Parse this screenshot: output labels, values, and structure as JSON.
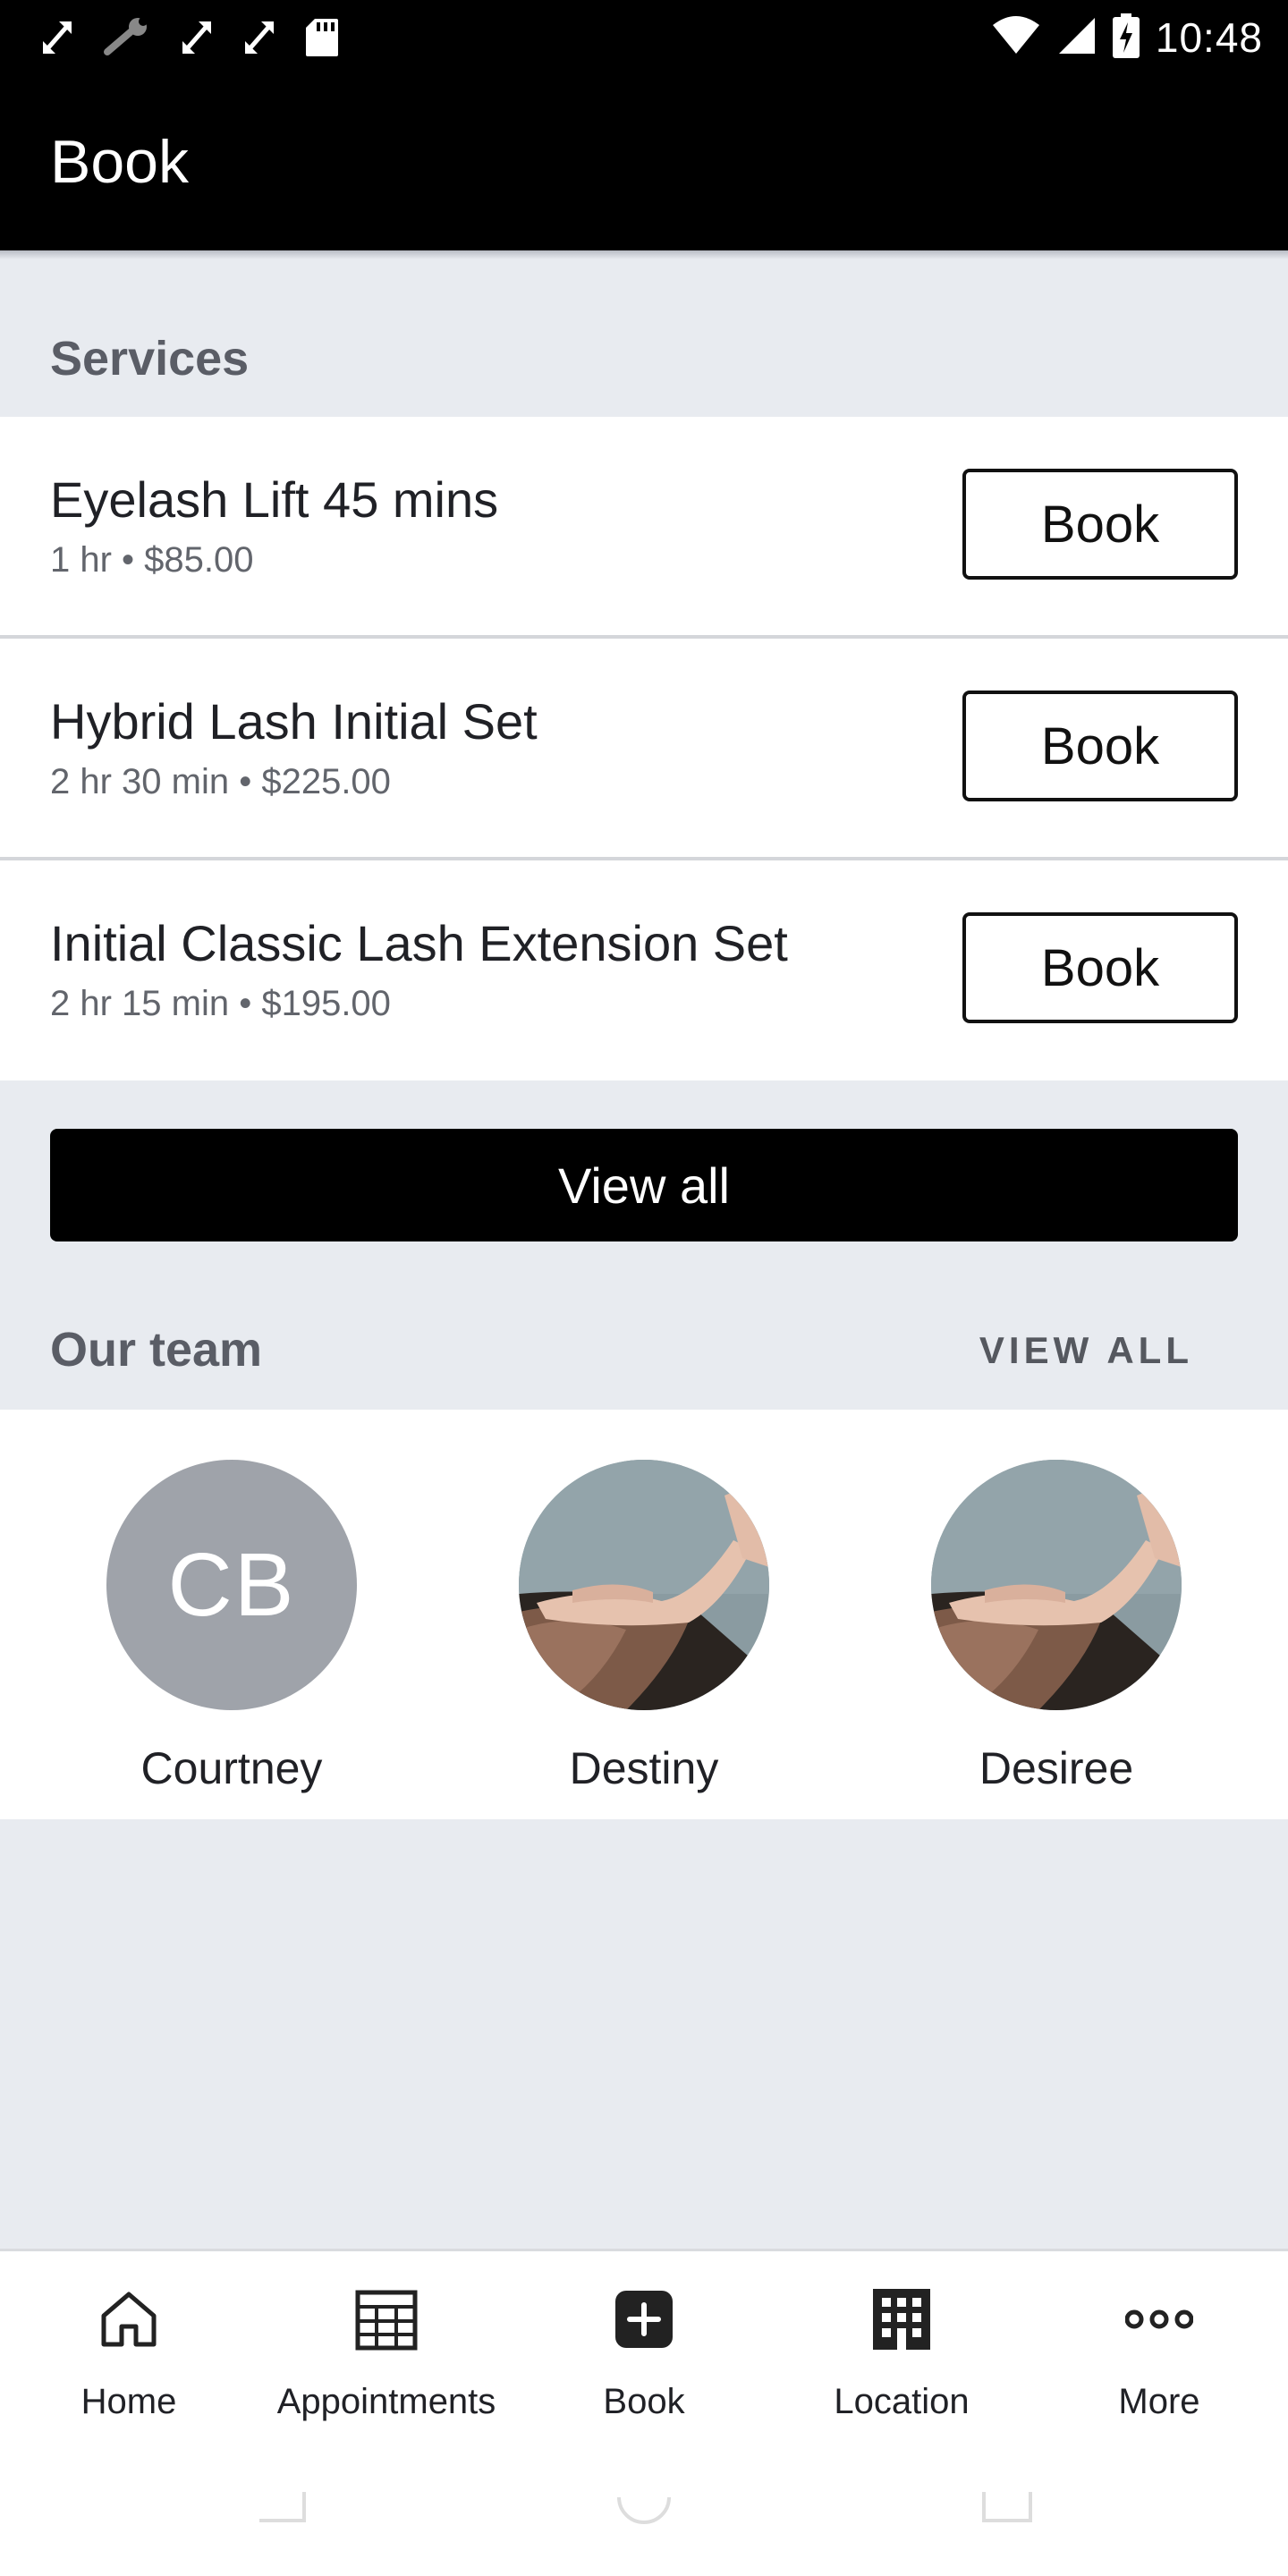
{
  "status_bar": {
    "time": "10:48",
    "left_icons": [
      "expand-arrows-icon",
      "wrench-icon",
      "expand-arrows-icon",
      "expand-arrows-icon",
      "sd-card-icon"
    ],
    "right_icons": [
      "wifi-icon",
      "cell-signal-icon",
      "battery-charging-icon"
    ]
  },
  "app_bar": {
    "title": "Book"
  },
  "services": {
    "heading": "Services",
    "book_label": "Book",
    "items": [
      {
        "name": "Eyelash Lift 45 mins",
        "meta": "1 hr • $85.00"
      },
      {
        "name": "Hybrid Lash Initial Set",
        "meta": "2 hr 30 min • $225.00"
      },
      {
        "name": "Initial Classic Lash Extension Set",
        "meta": "2 hr 15 min • $195.00"
      }
    ],
    "view_all_label": "View all"
  },
  "team": {
    "heading": "Our team",
    "view_all_label": "VIEW ALL",
    "members": [
      {
        "name": "Courtney",
        "initials": "CB"
      },
      {
        "name": "Destiny"
      },
      {
        "name": "Desiree"
      }
    ]
  },
  "bottom_nav": {
    "items": [
      {
        "label": "Home",
        "icon": "home-icon"
      },
      {
        "label": "Appointments",
        "icon": "calendar-grid-icon"
      },
      {
        "label": "Book",
        "icon": "plus-square-icon"
      },
      {
        "label": "Location",
        "icon": "building-icon"
      },
      {
        "label": "More",
        "icon": "more-dots-icon"
      }
    ]
  },
  "colors": {
    "accent": "#000000",
    "background": "#e8ebf0",
    "avatar_initials_bg": "#9fa3aa"
  }
}
